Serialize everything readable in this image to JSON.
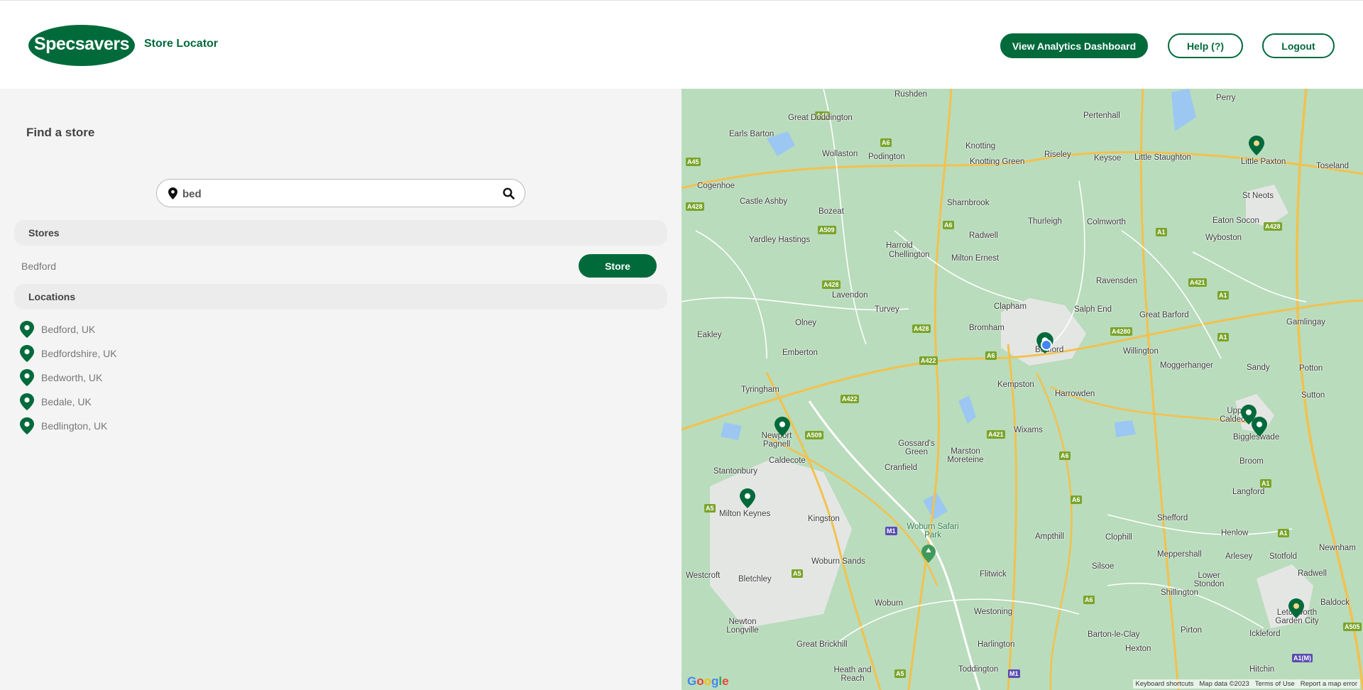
{
  "header": {
    "logo_text": "Specsavers",
    "subtitle": "Store Locator",
    "analytics_button": "View Analytics Dashboard",
    "help_button": "Help (?)",
    "logout_button": "Logout"
  },
  "panel": {
    "title": "Find a store",
    "search": {
      "value": "bed",
      "placeholder": ""
    },
    "stores_heading": "Stores",
    "stores": [
      {
        "name": "Bedford",
        "button": "Store"
      }
    ],
    "locations_heading": "Locations",
    "locations": [
      "Bedford, UK",
      "Bedfordshire, UK",
      "Bedworth, UK",
      "Bedale, UK",
      "Bedlington, UK"
    ]
  },
  "map": {
    "towns": [
      "Rushden",
      "Great Doddington",
      "Earls Barton",
      "Wollaston",
      "Podington",
      "Knotting",
      "Knotting Green",
      "Riseley",
      "Keysoe",
      "Little Staughton",
      "Pertenhall",
      "Perry",
      "Little Paxton",
      "Toseland",
      "Cogenhoe",
      "Castle Ashby",
      "Bozeat",
      "Sharnbrook",
      "Thurleigh",
      "Colmworth",
      "St Neots",
      "Eaton Socon",
      "Wyboston",
      "Yardley Hastings",
      "Harrold",
      "Chellington",
      "Radwell",
      "Milton Ernest",
      "Ravensden",
      "Lavendon",
      "Turvey",
      "Clapham",
      "Salph End",
      "Great Barford",
      "Gamlingay",
      "Olney",
      "Bromham",
      "Bedford",
      "Willington",
      "Moggerhanger",
      "Sandy",
      "Potton",
      "Eakley",
      "Emberton",
      "Kempston",
      "Harrowden",
      "Tyringham",
      "Upper Caldecote",
      "Biggleswade",
      "Sutton",
      "Newport Pagnell",
      "Gossard's Green",
      "Wixams",
      "Caldecote",
      "Cranfield",
      "Marston Moreteine",
      "Stantonbury",
      "Broom",
      "Langford",
      "Milton Keynes",
      "Kingston",
      "Woburn Safari Park",
      "Ampthill",
      "Clophill",
      "Shefford",
      "Henlow",
      "Meppershall",
      "Arlesey",
      "Stotfold",
      "Newnham",
      "Westcroft",
      "Bletchley",
      "Woburn Sands",
      "Flitwick",
      "Silsoe",
      "Lower Stondon",
      "Radwell",
      "Shillington",
      "Baldock",
      "Letchworth Garden City",
      "Woburn",
      "Westoning",
      "Pirton",
      "Ickleford",
      "Newton Longville",
      "Great Brickhill",
      "Harlington",
      "Barton-le-Clay",
      "Hexton",
      "Hitchin",
      "Heath and Reach",
      "Toddington"
    ],
    "footer": {
      "shortcuts": "Keyboard shortcuts",
      "map_data": "Map data ©2023",
      "terms": "Terms of Use",
      "report": "Report a map error"
    },
    "colors": {
      "land": "#b9dcbc",
      "urban": "#e4e6e4",
      "road_major": "#f2c14e",
      "road_minor": "#ffffff",
      "water": "#9bc7f2",
      "marker": "#006a3b"
    }
  }
}
